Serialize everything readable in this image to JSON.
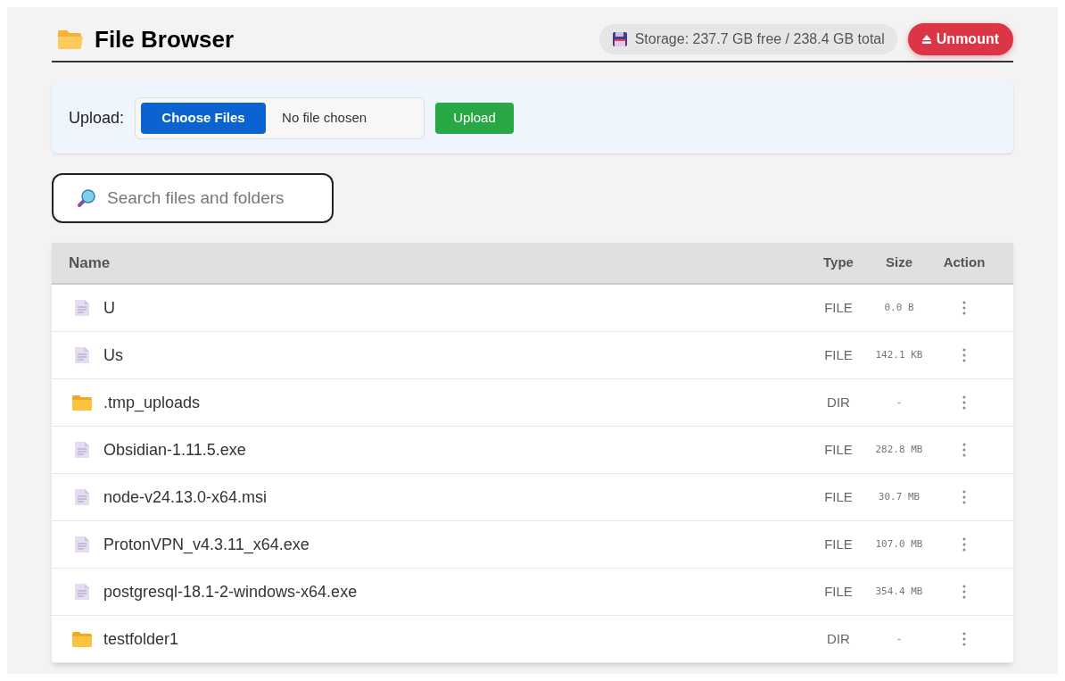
{
  "header": {
    "title": "File Browser",
    "storage": "Storage: 237.7 GB free / 238.4 GB total",
    "unmount": "Unmount"
  },
  "upload": {
    "label": "Upload:",
    "choose": "Choose Files",
    "status": "No file chosen",
    "button": "Upload"
  },
  "search": {
    "placeholder": "Search files and folders"
  },
  "table": {
    "columns": [
      "Name",
      "Type",
      "Size",
      "Action"
    ],
    "rows": [
      {
        "kind": "file",
        "name": "U",
        "type": "FILE",
        "size": "0.0 B"
      },
      {
        "kind": "file",
        "name": "Us",
        "type": "FILE",
        "size": "142.1 KB"
      },
      {
        "kind": "dir",
        "name": ".tmp_uploads",
        "type": "DIR",
        "size": "-"
      },
      {
        "kind": "file",
        "name": "Obsidian-1.11.5.exe",
        "type": "FILE",
        "size": "282.8 MB"
      },
      {
        "kind": "file",
        "name": "node-v24.13.0-x64.msi",
        "type": "FILE",
        "size": "30.7 MB"
      },
      {
        "kind": "file",
        "name": "ProtonVPN_v4.3.11_x64.exe",
        "type": "FILE",
        "size": "107.0 MB"
      },
      {
        "kind": "file",
        "name": "postgresql-18.1-2-windows-x64.exe",
        "type": "FILE",
        "size": "354.4 MB"
      },
      {
        "kind": "dir",
        "name": "testfolder1",
        "type": "DIR",
        "size": "-"
      }
    ]
  }
}
